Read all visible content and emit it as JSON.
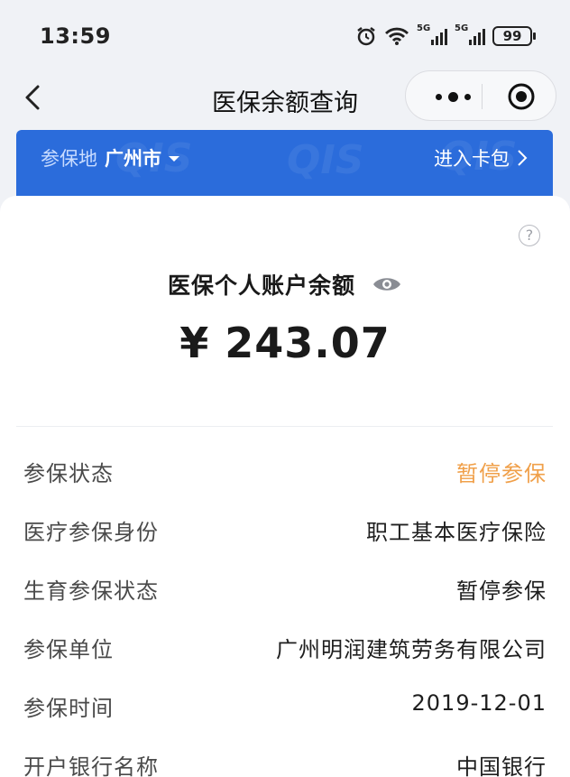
{
  "status_bar": {
    "time": "13:59",
    "sim1": "5G",
    "sim2": "5G",
    "battery": "99"
  },
  "nav": {
    "title": "医保余额查询",
    "icons": [
      "back-icon",
      "more-icon",
      "close-target-icon"
    ]
  },
  "banner": {
    "region_label": "参保地",
    "city": "广州市",
    "wallet_link": "进入卡包",
    "color": "#2b6cdb"
  },
  "account": {
    "title": "医保个人账户余额",
    "amount": "¥ 243.07",
    "help_icon": "?"
  },
  "details": [
    {
      "label": "参保状态",
      "value": "暂停参保",
      "highlight": true
    },
    {
      "label": "医疗参保身份",
      "value": "职工基本医疗保险"
    },
    {
      "label": "生育参保状态",
      "value": "暂停参保"
    },
    {
      "label": "参保单位",
      "value": "广州明润建筑劳务有限公司"
    },
    {
      "label": "参保时间",
      "value": "2019-12-01"
    },
    {
      "label": "开户银行名称",
      "value": "中国银行"
    }
  ],
  "colors": {
    "accent_blue": "#2b6cdb",
    "warning_orange": "#f0a04a"
  }
}
